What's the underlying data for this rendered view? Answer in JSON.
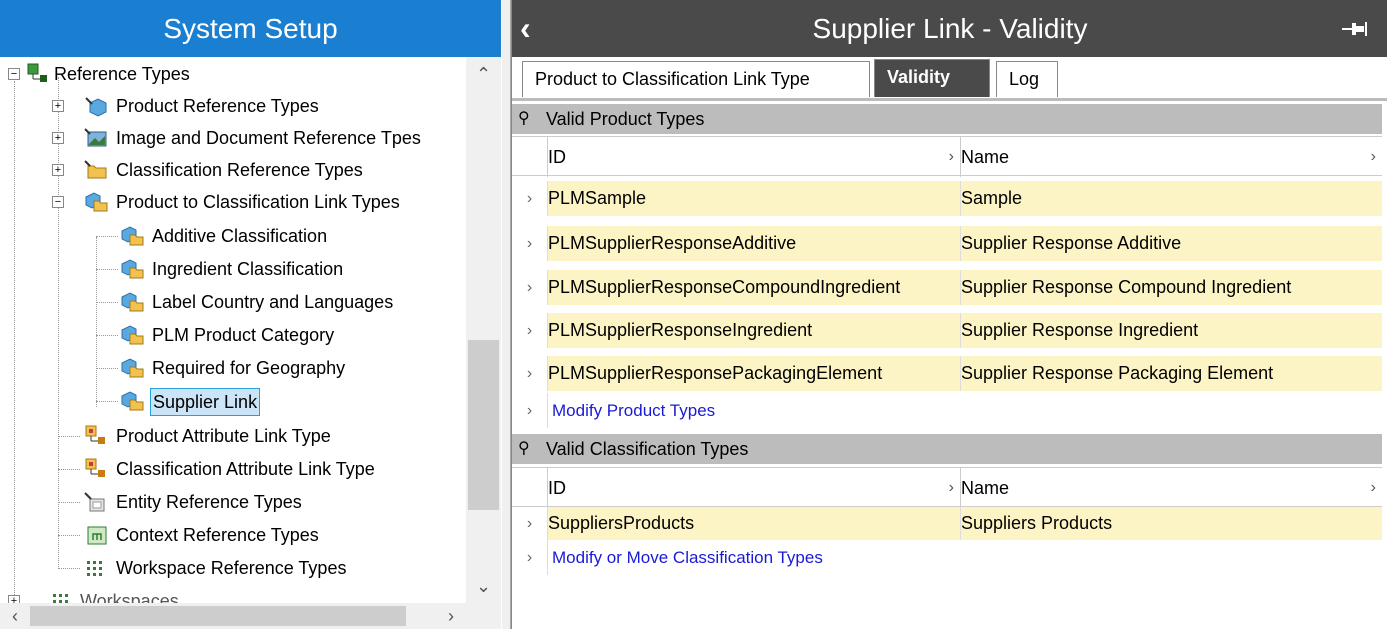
{
  "left_panel": {
    "title": "System Setup",
    "tree": [
      {
        "label": "Reference Types",
        "icon": "reference-types-icon"
      },
      {
        "label": "Product Reference Types",
        "icon": "product-reference-icon"
      },
      {
        "label": "Image and Document Reference Tpes",
        "icon": "image-document-icon"
      },
      {
        "label": "Classification Reference Types",
        "icon": "classification-folder-icon"
      },
      {
        "label": "Product to Classification Link Types",
        "icon": "link-type-icon"
      },
      {
        "label": "Additive Classification",
        "icon": "link-type-icon"
      },
      {
        "label": "Ingredient Classification",
        "icon": "link-type-icon"
      },
      {
        "label": "Label Country and Languages",
        "icon": "link-type-icon"
      },
      {
        "label": "PLM Product Category",
        "icon": "link-type-icon"
      },
      {
        "label": "Required for Geography",
        "icon": "link-type-icon"
      },
      {
        "label": "Supplier Link",
        "icon": "link-type-icon"
      },
      {
        "label": "Product Attribute Link Type",
        "icon": "attribute-link-icon"
      },
      {
        "label": "Classification Attribute Link Type",
        "icon": "attribute-link-icon"
      },
      {
        "label": "Entity Reference Types",
        "icon": "entity-reference-icon"
      },
      {
        "label": "Context Reference Types",
        "icon": "context-reference-icon"
      },
      {
        "label": "Workspace Reference Types",
        "icon": "workspace-reference-icon"
      },
      {
        "label": "Workspaces",
        "icon": "workspaces-icon"
      }
    ]
  },
  "right_panel": {
    "title": "Supplier Link - Validity",
    "tabs": [
      {
        "label": "Product to Classification Link Type"
      },
      {
        "label": "Validity"
      },
      {
        "label": "Log"
      }
    ],
    "valid_product_types": {
      "header": "Valid Product Types",
      "col_id": "ID",
      "col_name": "Name",
      "rows": [
        {
          "id": "PLMSample",
          "name": "Sample"
        },
        {
          "id": "PLMSupplierResponseAdditive",
          "name": "Supplier Response Additive"
        },
        {
          "id": "PLMSupplierResponseCompoundIngredient",
          "name": "Supplier Response Compound Ingredient"
        },
        {
          "id": "PLMSupplierResponseIngredient",
          "name": "Supplier Response Ingredient"
        },
        {
          "id": "PLMSupplierResponsePackagingElement",
          "name": "Supplier Response Packaging Element"
        }
      ],
      "modify_link": "Modify Product Types"
    },
    "valid_classification_types": {
      "header": "Valid Classification Types",
      "col_id": "ID",
      "col_name": "Name",
      "rows": [
        {
          "id": "SuppliersProducts",
          "name": "Suppliers Products"
        }
      ],
      "modify_link": "Modify or Move Classification Types"
    }
  },
  "colors": {
    "left_title_bg": "#1b7fd1",
    "right_title_bg": "#4a4a4a",
    "cell_bg": "#fdf4c5",
    "section_bg": "#bcbcbc",
    "link_text": "#1a1ad6"
  }
}
